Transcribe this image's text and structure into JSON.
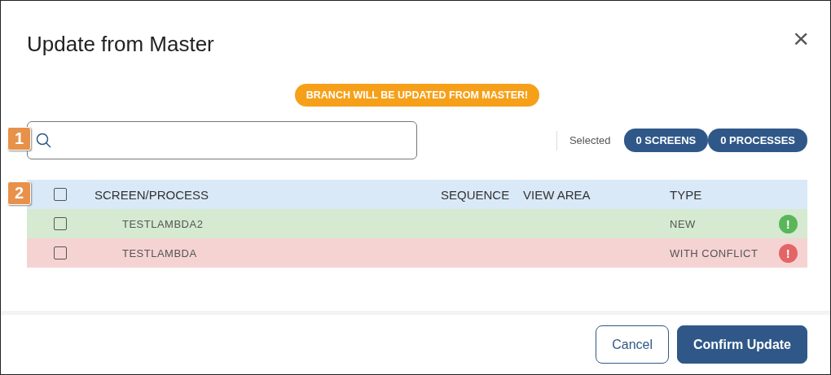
{
  "dialog": {
    "title": "Update from Master",
    "close": "×"
  },
  "banner": "BRANCH WILL BE UPDATED FROM MASTER!",
  "search": {
    "callout": "1"
  },
  "selected": {
    "label": "Selected",
    "pills": [
      "0 SCREENS",
      "0 PROCESSES"
    ]
  },
  "table": {
    "callout": "2",
    "header_checked": false,
    "columns": [
      "SCREEN/PROCESS",
      "SEQUENCE",
      "VIEW AREA",
      "TYPE"
    ],
    "rows": [
      {
        "name": "TESTLAMBDA2",
        "type": "NEW",
        "kind": "new",
        "checked": false,
        "status_icon": "!"
      },
      {
        "name": "TESTLAMBDA",
        "type": "WITH CONFLICT",
        "kind": "conflict",
        "checked": false,
        "status_icon": "!"
      }
    ]
  },
  "buttons": {
    "cancel": "Cancel",
    "confirm": "Confirm Update"
  }
}
